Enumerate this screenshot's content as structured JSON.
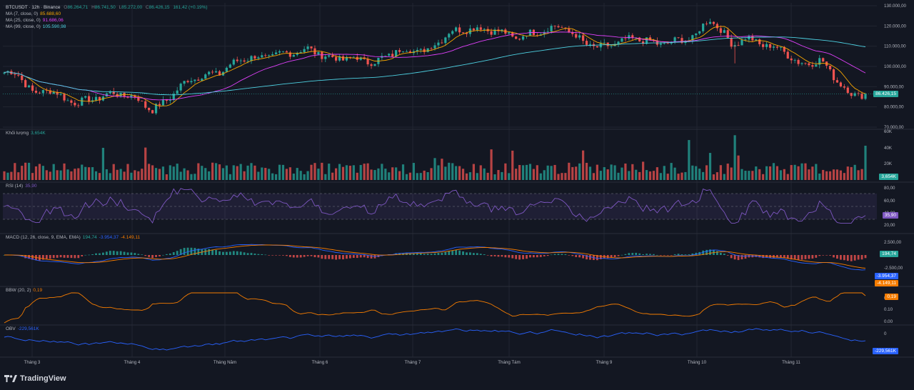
{
  "header": {
    "symbol": "BTCUSDT · 12h · Binance",
    "open_label": "O",
    "open": "86.264,71",
    "high_label": "H",
    "high": "86.741,50",
    "low_label": "L",
    "low": "85.272,00",
    "close_label": "C",
    "close": "86.426,15",
    "change": "161,42 (+0.19%)"
  },
  "ma_legends": [
    {
      "label": "MA (7, close, 0)",
      "value": "85.688,60",
      "color": "#f7a600"
    },
    {
      "label": "MA (25, close, 0)",
      "value": "91.686,06",
      "color": "#e040fb"
    },
    {
      "label": "MA (99, close, 0)",
      "value": "105.590,98",
      "color": "#4dd0e1"
    }
  ],
  "panes": {
    "volume": {
      "label": "Khối lượng",
      "value": "3,654K",
      "value_color": "#26a69a",
      "last_tag": "3,654K"
    },
    "rsi": {
      "label": "RSI (14)",
      "value": "35,90",
      "last_tag": "35,90",
      "color": "#7e57c2"
    },
    "macd": {
      "label": "MACD (12, 26, close, 9, EMA, EMA)",
      "v1": "194,74",
      "v2": "-3.954,37",
      "v3": "-4.149,11",
      "tag_hist": "194,74",
      "tag_macd": "-3.954,37",
      "tag_signal": "-4.149,11"
    },
    "bbw": {
      "label": "BBW (20, 2)",
      "value": "0,19",
      "last_tag": "0,19",
      "color": "#f57c00"
    },
    "obv": {
      "label": "OBV",
      "value": "-229,561K",
      "last_tag": "-229,561K",
      "color": "#2962ff"
    }
  },
  "price_tag": "86.426,15",
  "branding": "TradingView",
  "colors": {
    "up": "#26a69a",
    "down": "#ef5350",
    "background": "#131722",
    "grid": "#222631",
    "text": "#b2b5be"
  },
  "chart_data": {
    "type": "candlestick",
    "symbol": "BTCUSDT",
    "interval": "12h",
    "exchange": "Binance",
    "x_ticks": [
      "Tháng 3",
      "Tháng 4",
      "Tháng Năm",
      "Tháng 6",
      "Tháng 7",
      "Tháng Tám",
      "Tháng 9",
      "Tháng 10",
      "Tháng 11"
    ],
    "price_axis": {
      "ticks": [
        "130.000,00",
        "120.000,00",
        "110.000,00",
        "100.000,00",
        "90.000,00",
        "80.000,00",
        "70.000,00"
      ],
      "ylim": [
        70000,
        130000
      ]
    },
    "price_anchors": [
      [
        0,
        97000
      ],
      [
        0.02,
        96000
      ],
      [
        0.04,
        86000
      ],
      [
        0.06,
        89000
      ],
      [
        0.08,
        84000
      ],
      [
        0.1,
        82000
      ],
      [
        0.12,
        84000
      ],
      [
        0.15,
        87000
      ],
      [
        0.18,
        84000
      ],
      [
        0.2,
        78000
      ],
      [
        0.22,
        84000
      ],
      [
        0.25,
        94000
      ],
      [
        0.29,
        97000
      ],
      [
        0.32,
        104000
      ],
      [
        0.35,
        104500
      ],
      [
        0.38,
        106500
      ],
      [
        0.41,
        108500
      ],
      [
        0.44,
        104000
      ],
      [
        0.47,
        104000
      ],
      [
        0.5,
        102000
      ],
      [
        0.53,
        108000
      ],
      [
        0.57,
        108000
      ],
      [
        0.6,
        117000
      ],
      [
        0.63,
        119000
      ],
      [
        0.66,
        118000
      ],
      [
        0.69,
        114000
      ],
      [
        0.72,
        117500
      ],
      [
        0.75,
        120000
      ],
      [
        0.78,
        112000
      ],
      [
        0.8,
        109000
      ],
      [
        0.82,
        111000
      ],
      [
        0.85,
        114000
      ],
      [
        0.88,
        111000
      ],
      [
        0.9,
        112000
      ],
      [
        0.93,
        114500
      ],
      [
        0.95,
        124000
      ],
      [
        0.96,
        120000
      ],
      [
        0.98,
        111000
      ],
      [
        1.0,
        114000
      ],
      [
        1.02,
        111000
      ],
      [
        1.05,
        108000
      ],
      [
        1.07,
        101000
      ],
      [
        1.1,
        103000
      ],
      [
        1.12,
        94000
      ],
      [
        1.14,
        86000
      ],
      [
        1.16,
        86426
      ]
    ],
    "last_price": 86426.15,
    "indicators": {
      "ma7_last": 85688.6,
      "ma25_last": 91686.06,
      "ma99_last": 105590.98,
      "volume_last": "3,654K",
      "volume_axis": [
        "60K",
        "40K",
        "20K"
      ],
      "rsi_last": 35.9,
      "rsi_axis": [
        "80,00",
        "60,00",
        "40,00",
        "20,00"
      ],
      "macd_hist_last": 194.74,
      "macd_last": -3954.37,
      "signal_last": -4149.11,
      "macd_axis": [
        "2.500,00",
        "0",
        "-2.500,00"
      ],
      "bbw_last": 0.19,
      "bbw_axis": [
        "0.20",
        "0.10",
        "0.00"
      ],
      "obv_last": "-229,561K",
      "obv_axis": [
        "0"
      ]
    }
  }
}
